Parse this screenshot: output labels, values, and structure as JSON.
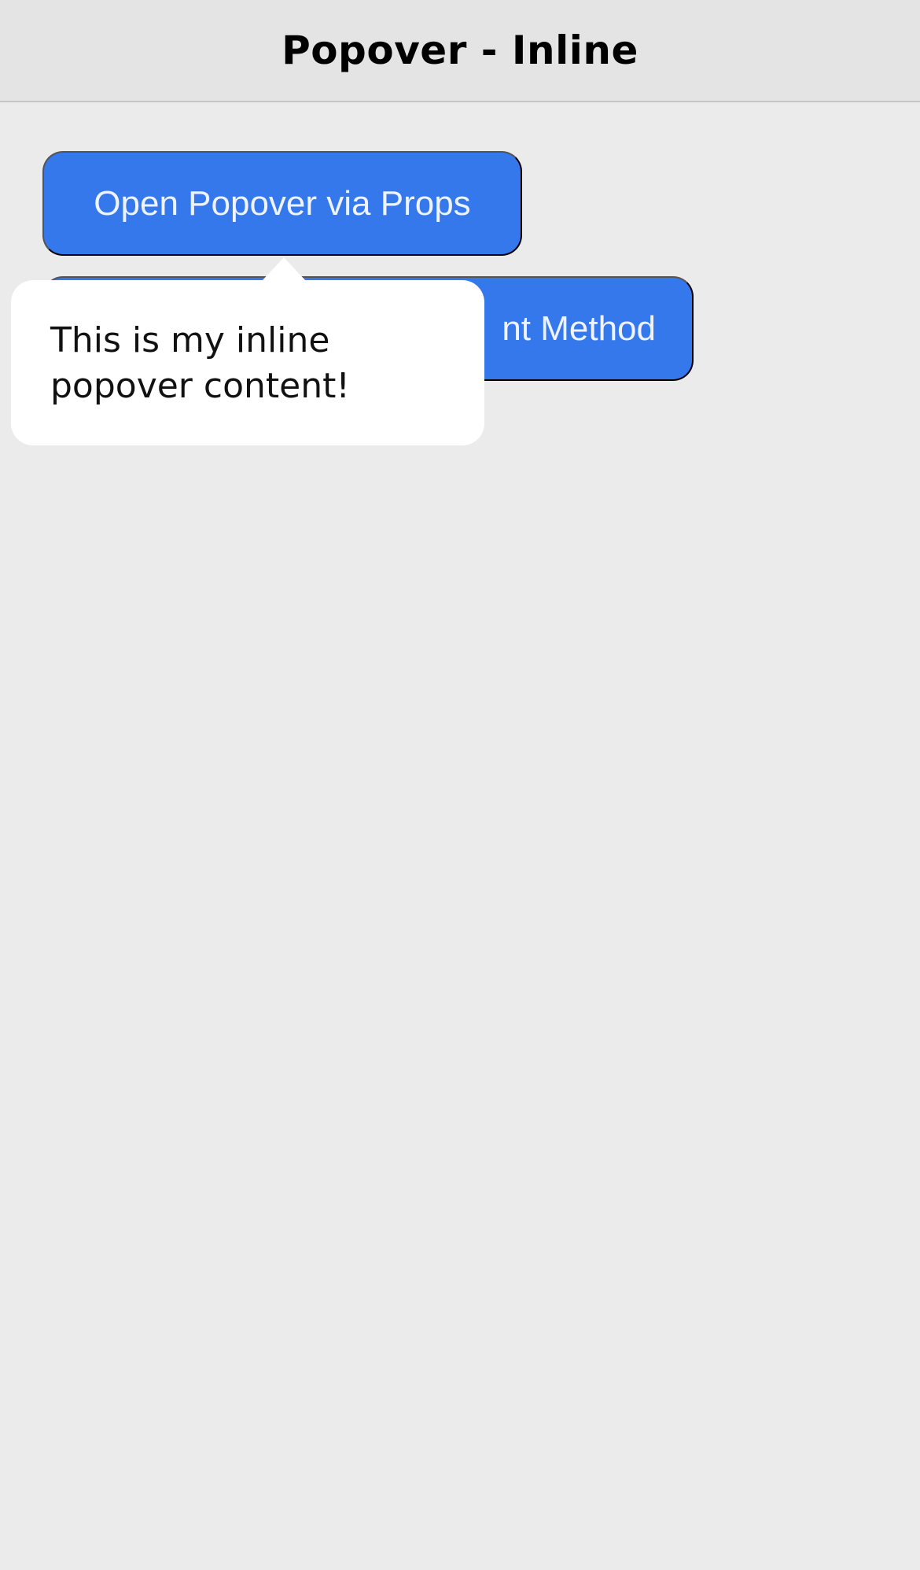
{
  "toolbar": {
    "title": "Popover - Inline"
  },
  "buttons": {
    "open_via_props": "Open Popover via Props",
    "open_via_method_visible": "nt Method"
  },
  "popover": {
    "content": "This is my inline popover content!"
  },
  "colors": {
    "background": "#ebebeb",
    "toolbar": "#e4e4e4",
    "primary_button": "#3478ec",
    "popover": "#ffffff"
  }
}
